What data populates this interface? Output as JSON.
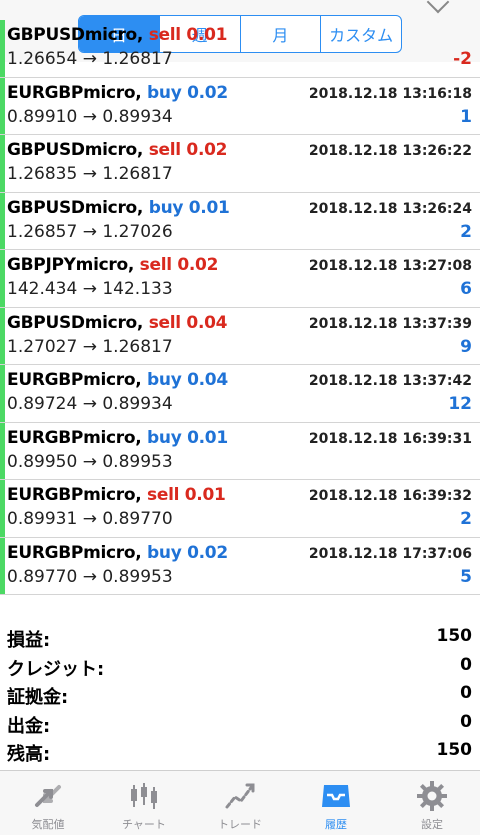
{
  "segments": [
    {
      "label": "日",
      "active": true
    },
    {
      "label": "週",
      "active": false
    },
    {
      "label": "月",
      "active": false
    },
    {
      "label": "カスタム",
      "active": false
    }
  ],
  "trades": [
    {
      "symbol": "GBPUSDmicro,",
      "side": "sell",
      "side_label": "sell 0.01",
      "time": "",
      "prices": "1.26654 → 1.26817",
      "profit": "-2",
      "profit_sign": "neg"
    },
    {
      "symbol": "EURGBPmicro,",
      "side": "buy",
      "side_label": "buy 0.02",
      "time": "2018.12.18 13:16:18",
      "prices": "0.89910 → 0.89934",
      "profit": "1",
      "profit_sign": "pos"
    },
    {
      "symbol": "GBPUSDmicro,",
      "side": "sell",
      "side_label": "sell 0.02",
      "time": "2018.12.18 13:26:22",
      "prices": "1.26835 → 1.26817",
      "profit": "",
      "profit_sign": "pos"
    },
    {
      "symbol": "GBPUSDmicro,",
      "side": "buy",
      "side_label": "buy 0.01",
      "time": "2018.12.18 13:26:24",
      "prices": "1.26857 → 1.27026",
      "profit": "2",
      "profit_sign": "pos"
    },
    {
      "symbol": "GBPJPYmicro,",
      "side": "sell",
      "side_label": "sell 0.02",
      "time": "2018.12.18 13:27:08",
      "prices": "142.434 → 142.133",
      "profit": "6",
      "profit_sign": "pos"
    },
    {
      "symbol": "GBPUSDmicro,",
      "side": "sell",
      "side_label": "sell 0.04",
      "time": "2018.12.18 13:37:39",
      "prices": "1.27027 → 1.26817",
      "profit": "9",
      "profit_sign": "pos"
    },
    {
      "symbol": "EURGBPmicro,",
      "side": "buy",
      "side_label": "buy 0.04",
      "time": "2018.12.18 13:37:42",
      "prices": "0.89724 → 0.89934",
      "profit": "12",
      "profit_sign": "pos"
    },
    {
      "symbol": "EURGBPmicro,",
      "side": "buy",
      "side_label": "buy 0.01",
      "time": "2018.12.18 16:39:31",
      "prices": "0.89950 → 0.89953",
      "profit": "",
      "profit_sign": "pos"
    },
    {
      "symbol": "EURGBPmicro,",
      "side": "sell",
      "side_label": "sell 0.01",
      "time": "2018.12.18 16:39:32",
      "prices": "0.89931 → 0.89770",
      "profit": "2",
      "profit_sign": "pos"
    },
    {
      "symbol": "EURGBPmicro,",
      "side": "buy",
      "side_label": "buy 0.02",
      "time": "2018.12.18 17:37:06",
      "prices": "0.89770 → 0.89953",
      "profit": "5",
      "profit_sign": "pos"
    }
  ],
  "summary": [
    {
      "label": "損益:",
      "value": "150"
    },
    {
      "label": "クレジット:",
      "value": "0"
    },
    {
      "label": "証拠金:",
      "value": "0"
    },
    {
      "label": "出金:",
      "value": "0"
    },
    {
      "label": "残高:",
      "value": "150"
    }
  ],
  "tabs": [
    {
      "label": "気配値",
      "icon": "quotes-icon",
      "active": false
    },
    {
      "label": "チャート",
      "icon": "chart-icon",
      "active": false
    },
    {
      "label": "トレード",
      "icon": "trade-icon",
      "active": false
    },
    {
      "label": "履歴",
      "icon": "history-icon",
      "active": true
    },
    {
      "label": "設定",
      "icon": "settings-icon",
      "active": false
    }
  ],
  "colors": {
    "accent": "#2d8ef2",
    "buy": "#1f72d6",
    "sell": "#d9291e",
    "indicator": "#4cd964"
  }
}
